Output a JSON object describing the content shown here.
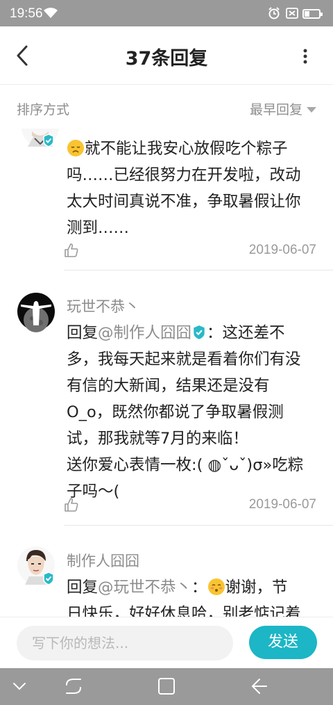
{
  "status_bar": {
    "time": "19:56"
  },
  "header": {
    "title": "37条回复"
  },
  "sort": {
    "label": "排序方式",
    "selected": "最早回复"
  },
  "comments": [
    {
      "author": "",
      "text_lines": [
        "就不能让我安心放假吃个粽子",
        "吗……已经很努力在开发啦，改动",
        "太大时间真说不准，争取暑假让你",
        "测到……"
      ],
      "date": "2019-06-07"
    },
    {
      "author": "玩世不恭丶",
      "reply_prefix": "回复",
      "mention": "@制作人囧囧",
      "reply_colon": "：这还差不",
      "text_lines": [
        "多，我每天起来就是看着你们有没",
        "有信的大新闻，结果还是没有",
        "O_o，既然你都说了争取暑假测",
        "试，那我就等7月的来临！",
        "送你爱心表情一枚:( ◍ˇᴗˇ)σ»吃粽",
        "子吗～("
      ],
      "date": "2019-06-07"
    },
    {
      "author": "制作人囧囧",
      "reply_prefix": "回复",
      "mention": "@玩世不恭丶",
      "reply_colon": "：",
      "text_after_emoji": "谢谢，节",
      "text_lines": [
        "日快乐，好好休息哈，别老惦记着"
      ]
    }
  ],
  "input": {
    "placeholder": "写下你的想法...",
    "send_label": "发送"
  },
  "colors": {
    "accent": "#1cb6c6",
    "verified": "#28b9c9"
  }
}
